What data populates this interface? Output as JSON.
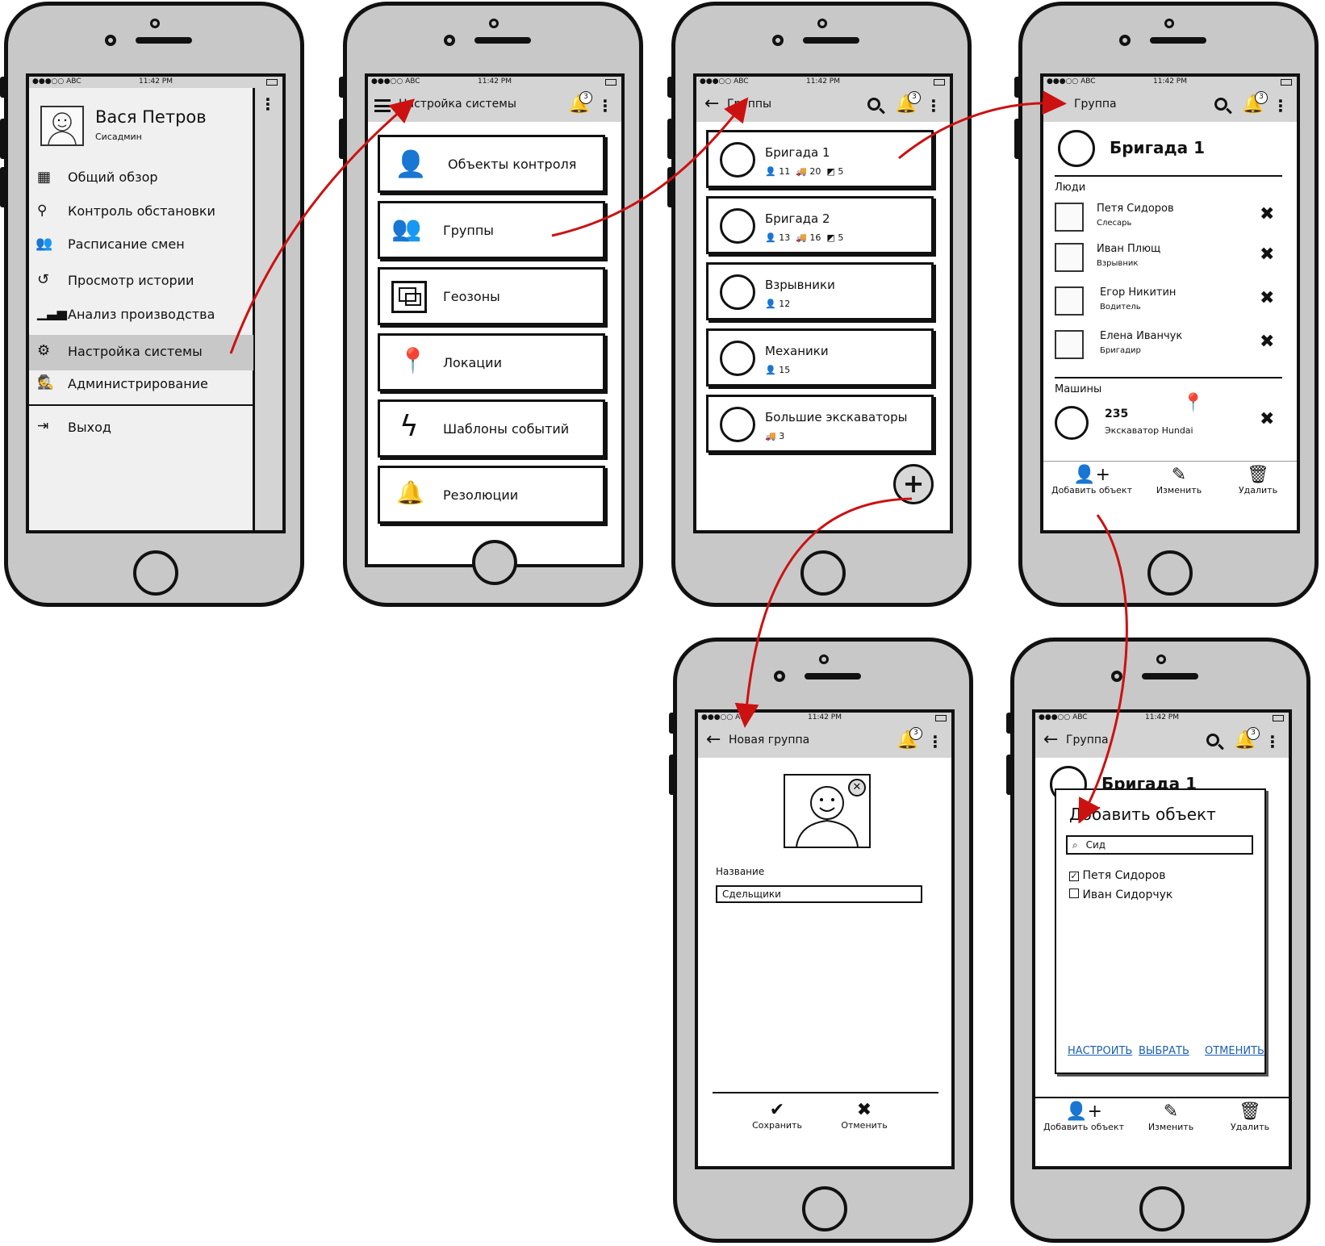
{
  "status": {
    "carrier": "●●●○○ ABC",
    "time": "11:42 PM"
  },
  "screen1": {
    "user_name": "Вася Петров",
    "user_role": "Сисадмин",
    "menu": [
      {
        "label": "Общий обзор",
        "icon": "dashboard-icon"
      },
      {
        "label": "Контроль обстановки",
        "icon": "binoculars-icon"
      },
      {
        "label": "Расписание смен",
        "icon": "users-icon"
      },
      {
        "label": "Просмотр истории",
        "icon": "history-icon"
      },
      {
        "label": "Анализ производства",
        "icon": "bar-chart-icon"
      },
      {
        "label": "Настройка системы",
        "icon": "gears-icon"
      },
      {
        "label": "Администрирование",
        "icon": "user-secret-icon"
      }
    ],
    "logout": "Выход"
  },
  "screen2": {
    "title": "Настройка системы",
    "badge": "3",
    "items": [
      {
        "label": "Объекты контроля",
        "icon": "user-icon"
      },
      {
        "label": "Группы",
        "icon": "users-icon"
      },
      {
        "label": "Геозоны",
        "icon": "geozone-icon"
      },
      {
        "label": "Локации",
        "icon": "map-marker-icon"
      },
      {
        "label": "Шаблоны событий",
        "icon": "bolt-icon"
      },
      {
        "label": "Резолюции",
        "icon": "bell-icon"
      }
    ]
  },
  "screen3": {
    "title": "Группы",
    "badge": "3",
    "groups": [
      {
        "name": "Бригада 1",
        "people": "11",
        "trucks": "20",
        "events": "5"
      },
      {
        "name": "Бригада 2",
        "people": "13",
        "trucks": "16",
        "events": "5"
      },
      {
        "name": "Взрывники",
        "people": "12"
      },
      {
        "name": "Механики",
        "people": "15"
      },
      {
        "name": "Большие экскаваторы",
        "trucks": "3"
      }
    ]
  },
  "screen4": {
    "title": "Группа",
    "badge": "3",
    "group_name": "Бригада 1",
    "people_header": "Люди",
    "people": [
      {
        "name": "Петя Сидоров",
        "role": "Слесарь"
      },
      {
        "name": "Иван Плющ",
        "role": "Взрывник"
      },
      {
        "name": "Егор Никитин",
        "role": "Водитель"
      },
      {
        "name": "Елена Иванчук",
        "role": "Бригадир"
      }
    ],
    "machines_header": "Машины",
    "machine": {
      "id": "235",
      "name": "Экскаватор Hundai"
    },
    "actions": {
      "add": "Добавить объект",
      "edit": "Изменить",
      "delete": "Удалить"
    }
  },
  "screen5": {
    "title": "Новая группа",
    "badge": "3",
    "name_label": "Название",
    "name_value": "Сдельщики",
    "save": "Сохранить",
    "cancel": "Отменить"
  },
  "screen6": {
    "title": "Группа",
    "badge": "3",
    "bg_group_name": "Бригада 1",
    "dialog": {
      "title": "Добавить объект",
      "search_value": "Сид",
      "options": [
        {
          "label": "Петя Сидоров",
          "checked": true
        },
        {
          "label": "Иван Сидорчук",
          "checked": false
        }
      ],
      "configure": "НАСТРОИТЬ",
      "select": "ВЫБРАТЬ",
      "cancel": "ОТМЕНИТЬ"
    },
    "actions": {
      "add": "Добавить объект",
      "edit": "Изменить",
      "delete": "Удалить"
    }
  },
  "colors": {
    "arrow": "#cc1111",
    "appbar": "#d4d4d4",
    "phone": "#c8c8c8",
    "highlight": "#c8c8c8"
  }
}
